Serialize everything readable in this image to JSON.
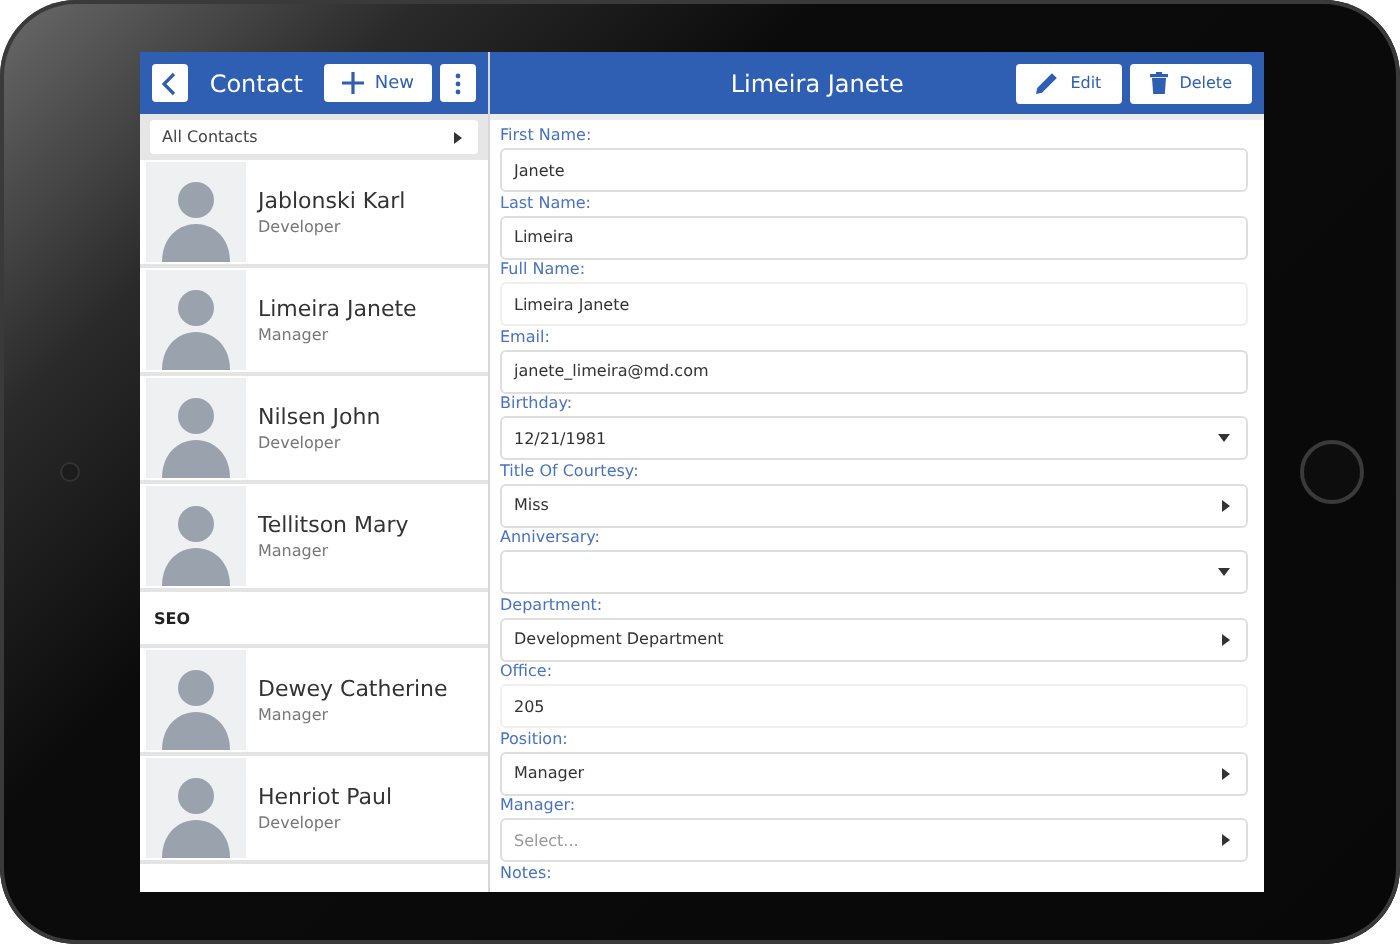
{
  "list_header": {
    "title": "Contact",
    "new_label": "New"
  },
  "filter": {
    "value": "All Contacts"
  },
  "contacts": [
    {
      "kind": "contact",
      "name": "Jablonski Karl",
      "role": "Developer"
    },
    {
      "kind": "contact",
      "name": "Limeira Janete",
      "role": "Manager"
    },
    {
      "kind": "contact",
      "name": "Nilsen John",
      "role": "Developer"
    },
    {
      "kind": "contact",
      "name": "Tellitson Mary",
      "role": "Manager"
    },
    {
      "kind": "group",
      "name": "SEO"
    },
    {
      "kind": "contact",
      "name": "Dewey Catherine",
      "role": "Manager"
    },
    {
      "kind": "contact",
      "name": "Henriot Paul",
      "role": "Developer"
    }
  ],
  "detail": {
    "title": "Limeira Janete",
    "actions": [
      {
        "kind": "edit",
        "label": "Edit"
      },
      {
        "kind": "delete",
        "label": "Delete"
      }
    ],
    "fields": [
      {
        "kind": "text",
        "label": "First Name:",
        "value": "Janete"
      },
      {
        "kind": "text",
        "label": "Last Name:",
        "value": "Limeira"
      },
      {
        "kind": "readonly",
        "label": "Full Name:",
        "value": "Limeira Janete"
      },
      {
        "kind": "text",
        "label": "Email:",
        "value": "janete_limeira@md.com"
      },
      {
        "kind": "date",
        "label": "Birthday:",
        "value": "12/21/1981"
      },
      {
        "kind": "select",
        "label": "Title Of Courtesy:",
        "value": "Miss"
      },
      {
        "kind": "date",
        "label": "Anniversary:"
      },
      {
        "kind": "select",
        "label": "Department:",
        "value": "Development Department"
      },
      {
        "kind": "readonly",
        "label": "Office:",
        "value": "205"
      },
      {
        "kind": "select",
        "label": "Position:",
        "value": "Manager"
      },
      {
        "kind": "select",
        "label": "Manager:",
        "placeholder": "Select..."
      },
      {
        "kind": "notes",
        "label": "Notes:"
      }
    ]
  }
}
